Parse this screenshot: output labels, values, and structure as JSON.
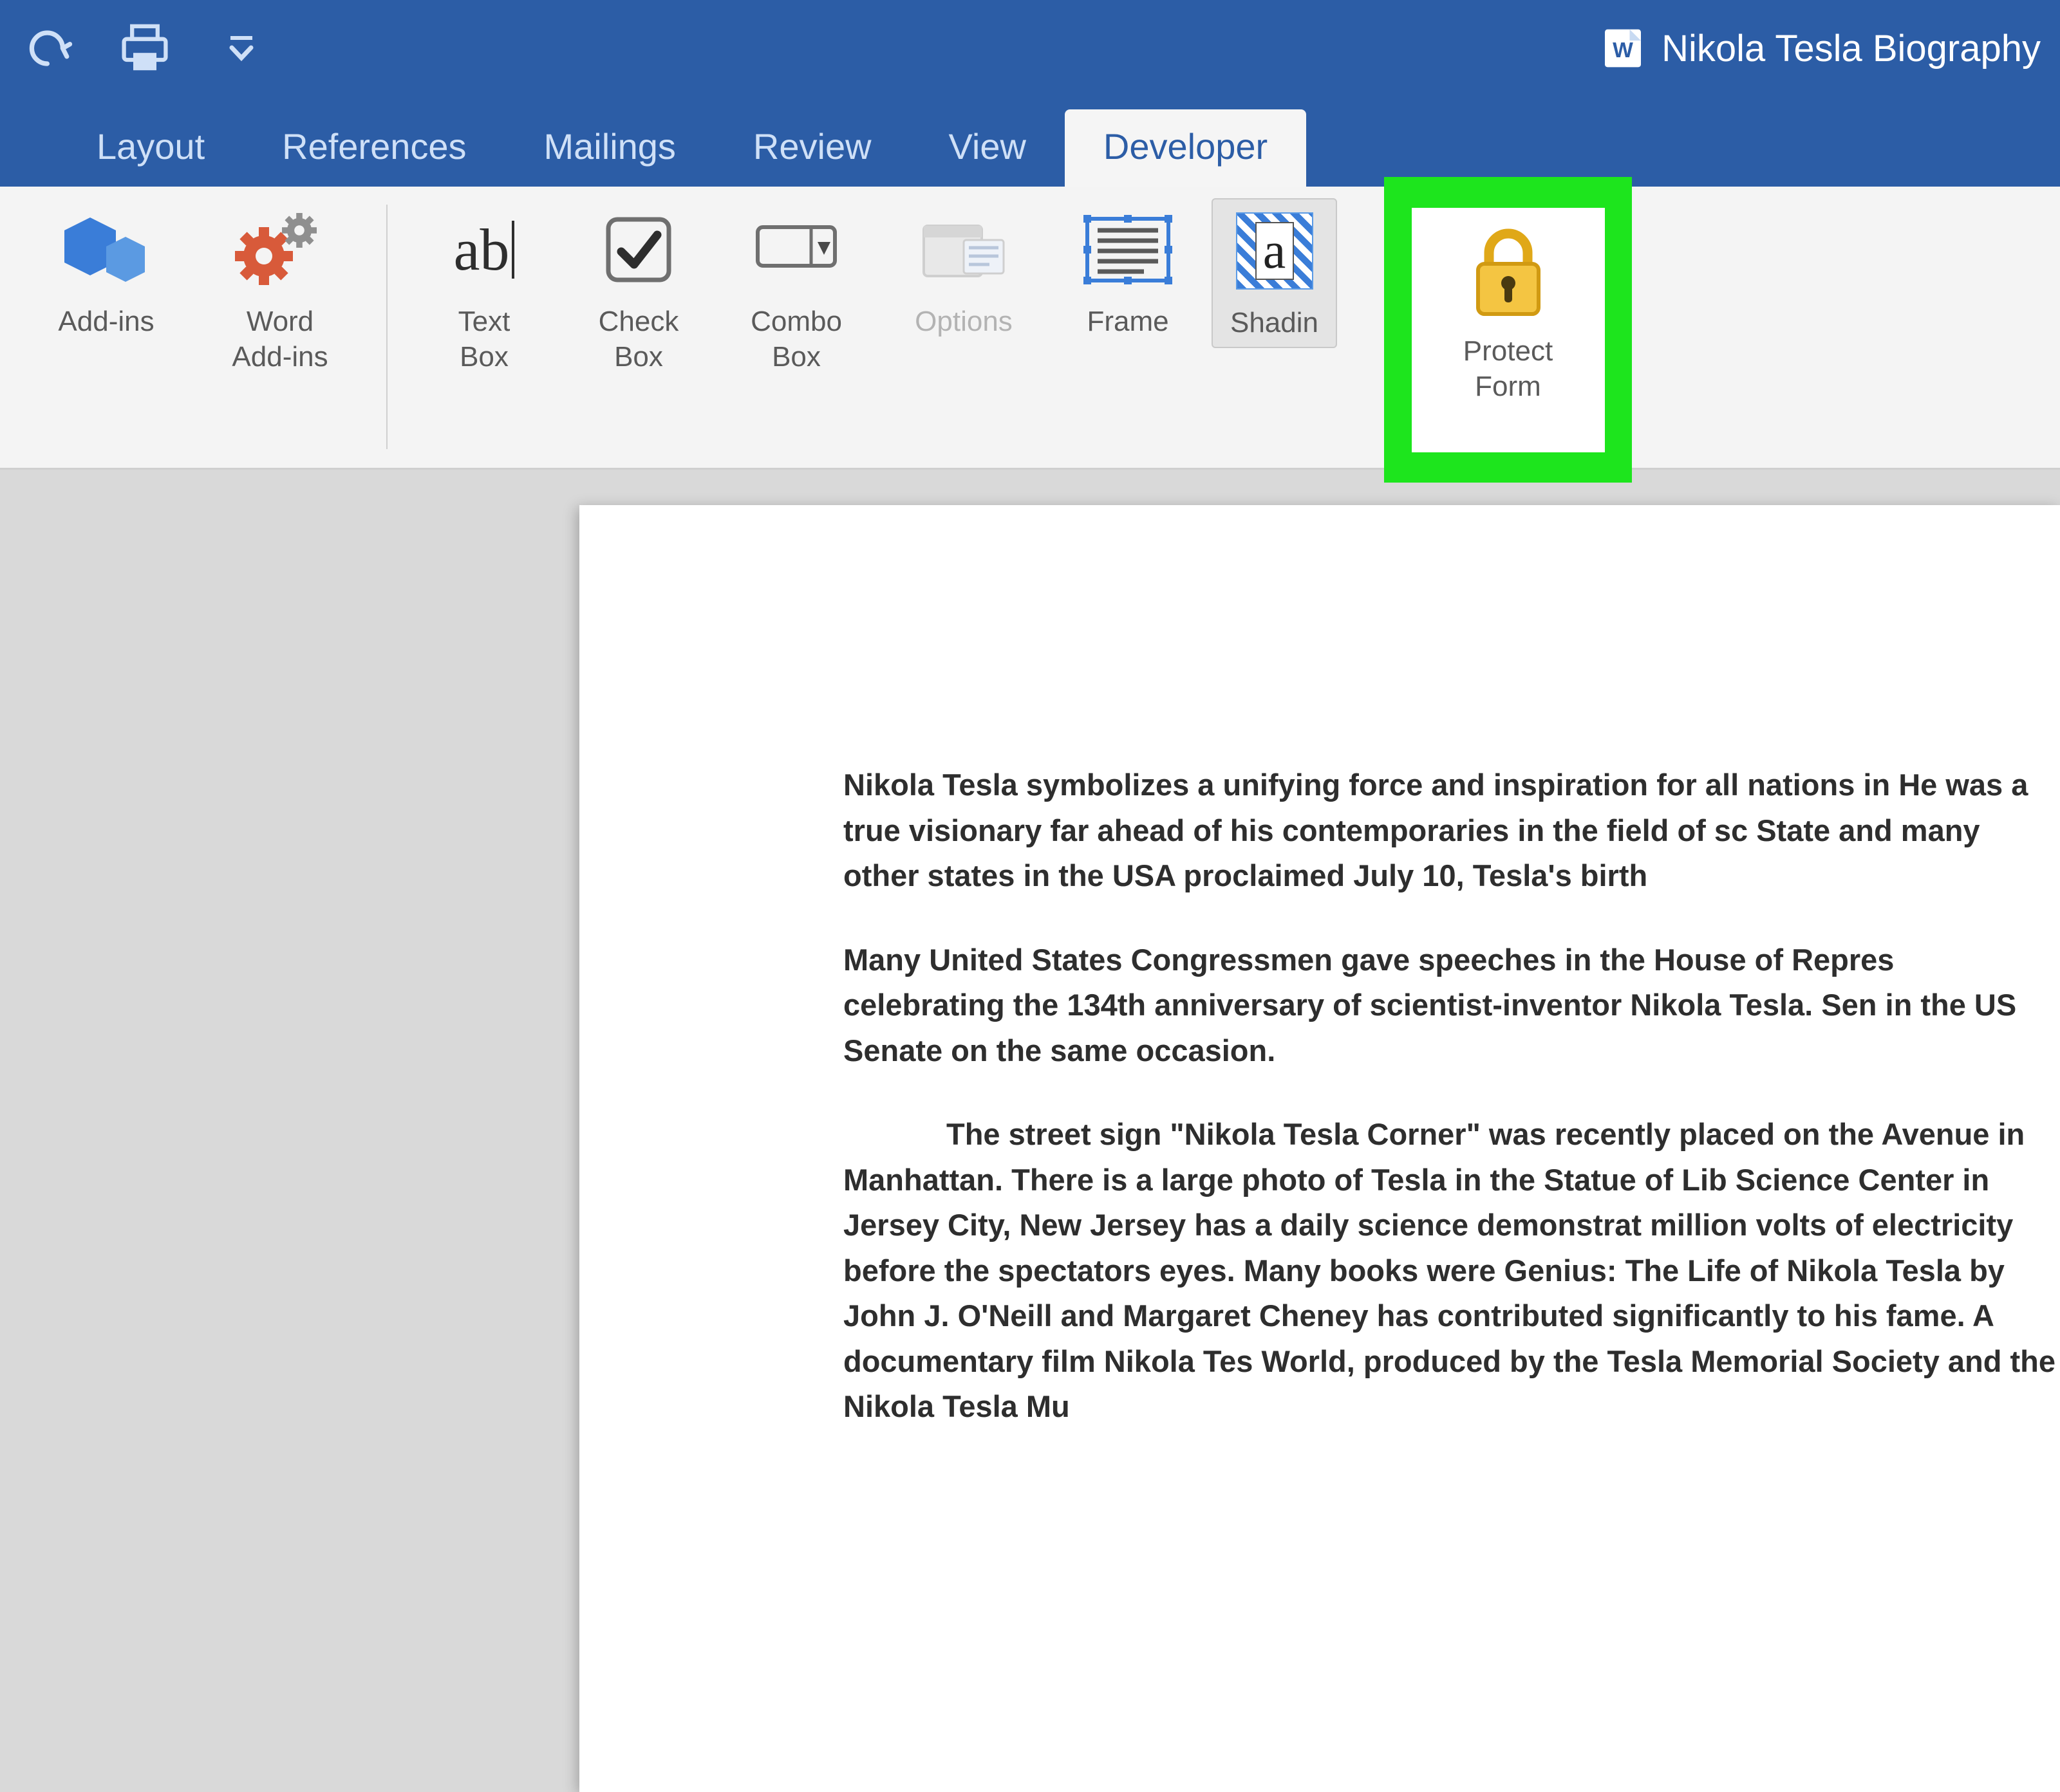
{
  "titlebar": {
    "document_title": "Nikola Tesla Biography"
  },
  "tabs": {
    "layout": "Layout",
    "references": "References",
    "mailings": "Mailings",
    "review": "Review",
    "view": "View",
    "developer": "Developer"
  },
  "ribbon": {
    "addins": "Add-ins",
    "word_addins": "Word\nAdd-ins",
    "text_box": "Text\nBox",
    "check_box": "Check\nBox",
    "combo_box": "Combo\nBox",
    "options": "Options",
    "frame": "Frame",
    "shading": "Shadin",
    "protect_form": "Protect\nForm"
  },
  "document": {
    "p1": "Nikola Tesla symbolizes a unifying force and inspiration for all nations in He was a true visionary far ahead of his contemporaries in the field of sc State and many other states in the USA proclaimed July 10, Tesla's birth",
    "p2": "Many United States Congressmen gave speeches in the House of Repres celebrating the 134th anniversary of scientist-inventor Nikola Tesla. Sen in the US Senate on the same occasion.",
    "p3": "The street sign \"Nikola Tesla Corner\" was recently placed on the Avenue in Manhattan. There is a large photo of Tesla in the Statue of Lib Science Center in Jersey City, New Jersey has a daily science demonstrat million volts of electricity before the spectators eyes. Many books were Genius: The Life of Nikola Tesla by John J. O'Neill  and Margaret Cheney has contributed significantly to his fame. A documentary film Nikola Tes World, produced by the Tesla Memorial Society and the Nikola Tesla Mu"
  }
}
